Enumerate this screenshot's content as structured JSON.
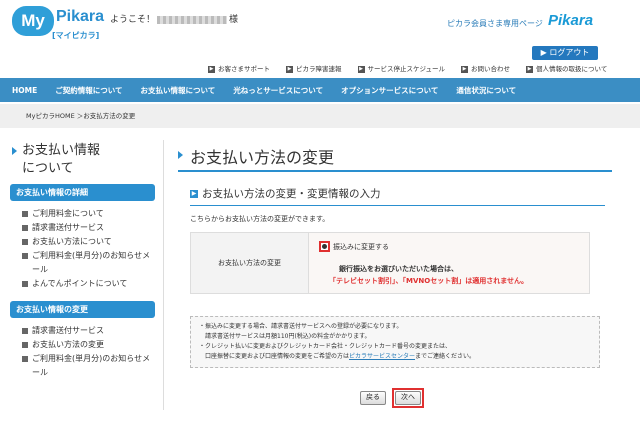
{
  "header": {
    "logo_my": "My",
    "logo_pikara": "Pikara",
    "logo_sub": "[マイピカラ]",
    "welcome_prefix": "ようこそ！",
    "welcome_suffix": "様",
    "member_page": "ピカラ会員さま専用ページ",
    "brand": "Pikara",
    "logout": "ログアウト",
    "util_links": [
      "お客さまサポート",
      "ピカラ障害速報",
      "サービス停止スケジュール",
      "お問い合わせ",
      "個人情報の取扱について"
    ]
  },
  "nav": [
    "HOME",
    "ご契約情報について",
    "お支払い情報について",
    "光ねっとサービスについて",
    "オプションサービスについて",
    "通信状況について"
  ],
  "breadcrumb": "MyピカラHOME ＞お支払方法の変更",
  "sidebar": {
    "title_line1": "お支払い情報",
    "title_line2": "について",
    "section1_head": "お支払い情報の詳細",
    "section1_items": [
      "ご利用料金について",
      "請求書送付サービス",
      "お支払い方法について",
      "ご利用料金(単月分)のお知らせメール",
      "よんでんポイントについて"
    ],
    "section2_head": "お支払い情報の変更",
    "section2_items": [
      "請求書送付サービス",
      "お支払い方法の変更",
      "ご利用料金(単月分)のお知らせメール"
    ]
  },
  "main": {
    "title": "お支払い方法の変更",
    "section_title": "お支払い方法の変更・変更情報の入力",
    "desc": "こちらからお支払い方法の変更ができます。",
    "form_label": "お支払い方法の変更",
    "radio_label": "振込みに変更する",
    "note1": "銀行振込をお選びいただいた場合は、",
    "note2": "「テレビセット割引」、「MVNOセット割」は適用されません。",
    "notice_lines": [
      "・振込みに変更する場合、請求書送付サービスへの登録が必要になります。",
      "　請求書送付サービスは月額110円(税込)の料金がかかります。",
      "・クレジット払いに変更およびクレジットカード会社・クレジットカード番号の変更または、",
      "　口座振替に変更および口座情報の変更をご希望の方は"
    ],
    "notice_link": "ピカラサービスセンター",
    "notice_tail": "までご連絡ください。",
    "back_button": "戻る",
    "next_button": "次へ"
  }
}
